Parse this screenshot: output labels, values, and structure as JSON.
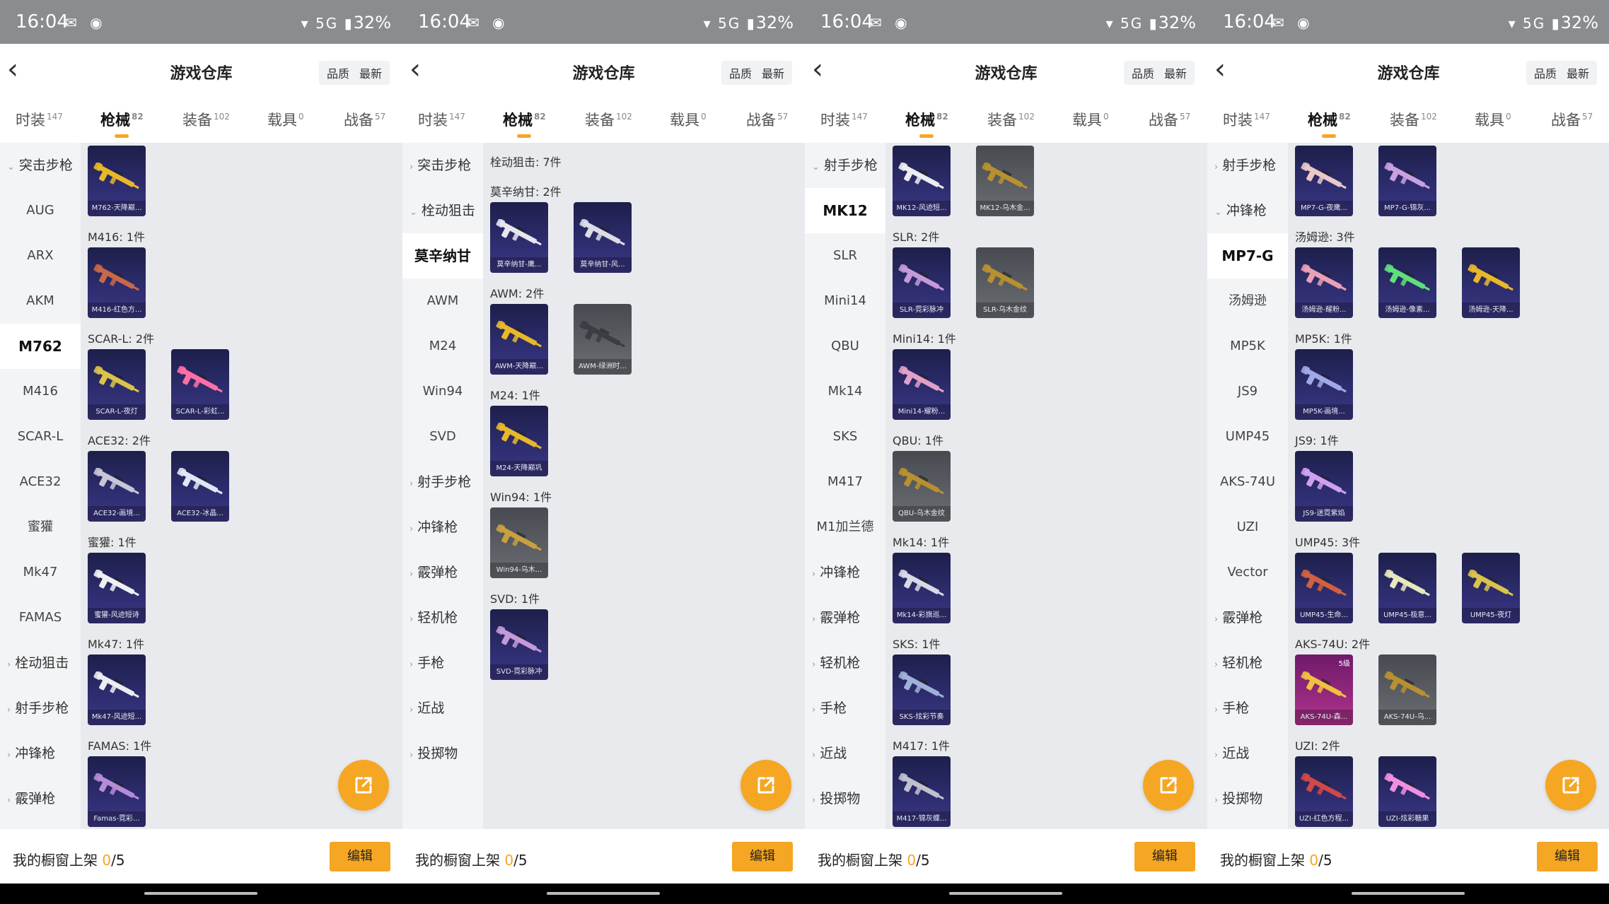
{
  "status": {
    "time": "16:04",
    "battery": "32%",
    "signal": "5G"
  },
  "header": {
    "title": "游戏仓库",
    "sort_quality": "品质",
    "sort_latest": "最新"
  },
  "tabs": [
    {
      "label": "时装",
      "count": "147"
    },
    {
      "label": "枪械",
      "count": "82"
    },
    {
      "label": "装备",
      "count": "102"
    },
    {
      "label": "载具",
      "count": "0"
    },
    {
      "label": "战备",
      "count": "57"
    }
  ],
  "bottom": {
    "label": "我的橱窗上架",
    "current": "0",
    "total": "/5",
    "edit": "编辑"
  },
  "colors": {
    "accent": "#f5a623",
    "card": "#2d2c6e",
    "card_grey": "#5a5d62",
    "card_pink": "#b1338c",
    "gold": "#e8b829"
  },
  "panels": [
    {
      "sidebar": [
        {
          "label": "突击步枪",
          "type": "group",
          "open": true
        },
        {
          "label": "AUG"
        },
        {
          "label": "ARX"
        },
        {
          "label": "AKM"
        },
        {
          "label": "M762",
          "selected": true
        },
        {
          "label": "M416"
        },
        {
          "label": "SCAR-L"
        },
        {
          "label": "ACE32"
        },
        {
          "label": "蜜獾"
        },
        {
          "label": "Mk47"
        },
        {
          "label": "FAMAS"
        },
        {
          "label": "栓动狙击",
          "type": "group"
        },
        {
          "label": "射手步枪",
          "type": "group"
        },
        {
          "label": "冲锋枪",
          "type": "group"
        },
        {
          "label": "霰弹枪",
          "type": "group"
        }
      ],
      "content": [
        {
          "header": "",
          "items": [
            {
              "name": "M762-天降巅...",
              "color": "#e8b829"
            }
          ]
        },
        {
          "header": "M416: 1件",
          "items": [
            {
              "name": "M416-红色方...",
              "color": "#c8684a"
            }
          ]
        },
        {
          "header": "SCAR-L: 2件",
          "items": [
            {
              "name": "SCAR-L-夜灯",
              "color": "#d9c34a"
            },
            {
              "name": "SCAR-L-彩虹...",
              "color": "#ff6fa6"
            }
          ]
        },
        {
          "header": "ACE32: 2件",
          "items": [
            {
              "name": "ACE32-画境...",
              "color": "#c6c6d8"
            },
            {
              "name": "ACE32-冰晶...",
              "color": "#dfe6f5"
            }
          ]
        },
        {
          "header": "蜜獾: 1件",
          "items": [
            {
              "name": "蜜獾-风迹短诗",
              "color": "#f0f0f4"
            }
          ]
        },
        {
          "header": "Mk47: 1件",
          "items": [
            {
              "name": "Mk47-风迹短...",
              "color": "#ececf2"
            }
          ]
        },
        {
          "header": "FAMAS: 1件",
          "items": [
            {
              "name": "Famas-霓彩...",
              "color": "#b68cd8"
            }
          ]
        }
      ]
    },
    {
      "sidebar": [
        {
          "label": "突击步枪",
          "type": "group"
        },
        {
          "label": "栓动狙击",
          "type": "group",
          "open": true
        },
        {
          "label": "莫辛纳甘",
          "selected": true
        },
        {
          "label": "AWM"
        },
        {
          "label": "M24"
        },
        {
          "label": "Win94"
        },
        {
          "label": "SVD"
        },
        {
          "label": "射手步枪",
          "type": "group"
        },
        {
          "label": "冲锋枪",
          "type": "group"
        },
        {
          "label": "霰弹枪",
          "type": "group"
        },
        {
          "label": "轻机枪",
          "type": "group"
        },
        {
          "label": "手枪",
          "type": "group"
        },
        {
          "label": "近战",
          "type": "group"
        },
        {
          "label": "投掷物",
          "type": "group"
        }
      ],
      "content": [
        {
          "header": "栓动狙击: 7件",
          "items": []
        },
        {
          "header": "莫辛纳甘: 2件",
          "items": [
            {
              "name": "莫辛纳甘-鹰...",
              "color": "#e6e6ee"
            },
            {
              "name": "莫辛纳甘-风...",
              "color": "#dcdce6"
            }
          ]
        },
        {
          "header": "AWM: 2件",
          "items": [
            {
              "name": "AWM-天降巅...",
              "color": "#e8b829"
            },
            {
              "name": "AWM-绿洲时...",
              "color": "#3a3d44",
              "bg": "grey"
            }
          ]
        },
        {
          "header": "M24: 1件",
          "items": [
            {
              "name": "M24-天降巅巩",
              "color": "#e8b829"
            }
          ]
        },
        {
          "header": "Win94: 1件",
          "items": [
            {
              "name": "Win94-乌木...",
              "color": "#c8a040",
              "bg": "grey"
            }
          ]
        },
        {
          "header": "SVD: 1件",
          "items": [
            {
              "name": "SVD-霓彩脉冲",
              "color": "#c49ad8"
            }
          ]
        }
      ]
    },
    {
      "sidebar": [
        {
          "label": "射手步枪",
          "type": "group",
          "open": true
        },
        {
          "label": "MK12",
          "selected": true
        },
        {
          "label": "SLR"
        },
        {
          "label": "Mini14"
        },
        {
          "label": "QBU"
        },
        {
          "label": "Mk14"
        },
        {
          "label": "SKS"
        },
        {
          "label": "M417"
        },
        {
          "label": "M1加兰德"
        },
        {
          "label": "冲锋枪",
          "type": "group"
        },
        {
          "label": "霰弹枪",
          "type": "group"
        },
        {
          "label": "轻机枪",
          "type": "group"
        },
        {
          "label": "手枪",
          "type": "group"
        },
        {
          "label": "近战",
          "type": "group"
        },
        {
          "label": "投掷物",
          "type": "group"
        }
      ],
      "content": [
        {
          "header": "",
          "items": [
            {
              "name": "MK12-风迹短...",
              "color": "#ececf2"
            },
            {
              "name": "MK12-乌木金...",
              "color": "#b89030",
              "bg": "grey"
            }
          ]
        },
        {
          "header": "SLR: 2件",
          "items": [
            {
              "name": "SLR-霓彩脉冲",
              "color": "#c49ad8"
            },
            {
              "name": "SLR-乌木金纹",
              "color": "#b89030",
              "bg": "grey"
            }
          ]
        },
        {
          "header": "Mini14: 1件",
          "items": [
            {
              "name": "Mini14-耀粉...",
              "color": "#e0a0c8"
            }
          ]
        },
        {
          "header": "QBU: 1件",
          "items": [
            {
              "name": "QBU-乌木金纹",
              "color": "#b89030",
              "bg": "grey"
            }
          ]
        },
        {
          "header": "Mk14: 1件",
          "items": [
            {
              "name": "Mk14-彩旗巡...",
              "color": "#d8d8e6"
            }
          ]
        },
        {
          "header": "SKS: 1件",
          "items": [
            {
              "name": "SKS-炫彩节奏",
              "color": "#a0b0d8"
            }
          ]
        },
        {
          "header": "M417: 1件",
          "items": [
            {
              "name": "M417-锦灰蝶...",
              "color": "#c0c0d0"
            }
          ]
        }
      ]
    },
    {
      "sidebar": [
        {
          "label": "射手步枪",
          "type": "group"
        },
        {
          "label": "冲锋枪",
          "type": "group",
          "open": true
        },
        {
          "label": "MP7-G",
          "selected": true
        },
        {
          "label": "汤姆逊"
        },
        {
          "label": "MP5K"
        },
        {
          "label": "JS9"
        },
        {
          "label": "UMP45"
        },
        {
          "label": "AKS-74U"
        },
        {
          "label": "UZI"
        },
        {
          "label": "Vector"
        },
        {
          "label": "霰弹枪",
          "type": "group"
        },
        {
          "label": "轻机枪",
          "type": "group"
        },
        {
          "label": "手枪",
          "type": "group"
        },
        {
          "label": "近战",
          "type": "group"
        },
        {
          "label": "投掷物",
          "type": "group"
        }
      ],
      "content": [
        {
          "header": "",
          "items": [
            {
              "name": "MP7-G-夜鹰...",
              "color": "#e8c8c8"
            },
            {
              "name": "MP7-G-锦灰...",
              "color": "#c8a0e0"
            }
          ]
        },
        {
          "header": "汤姆逊: 3件",
          "items": [
            {
              "name": "汤姆逊-耀粉...",
              "color": "#e8a0b8"
            },
            {
              "name": "汤姆逊-像素...",
              "color": "#5ee07a"
            },
            {
              "name": "汤姆逊-天降...",
              "color": "#e8b829"
            }
          ]
        },
        {
          "header": "MP5K: 1件",
          "items": [
            {
              "name": "MP5K-画境...",
              "color": "#a0a8e8"
            }
          ]
        },
        {
          "header": "JS9: 1件",
          "items": [
            {
              "name": "JS9-迷霓紫焰",
              "color": "#d0a0f0"
            }
          ]
        },
        {
          "header": "UMP45: 3件",
          "items": [
            {
              "name": "UMP45-生命...",
              "color": "#d06040"
            },
            {
              "name": "UMP45-极意...",
              "color": "#e8e8c0"
            },
            {
              "name": "UMP45-夜灯",
              "color": "#d9c34a"
            }
          ]
        },
        {
          "header": "AKS-74U: 2件",
          "items": [
            {
              "name": "AKS-74U-森...",
              "color": "#f0c040",
              "bg": "pink",
              "badge": "5级"
            },
            {
              "name": "AKS-74U-乌...",
              "color": "#b89030",
              "bg": "grey"
            }
          ]
        },
        {
          "header": "UZI: 2件",
          "items": [
            {
              "name": "UZI-红色方程...",
              "color": "#d04848"
            },
            {
              "name": "UZI-炫彩糖果",
              "color": "#f090e0"
            }
          ]
        }
      ]
    }
  ]
}
